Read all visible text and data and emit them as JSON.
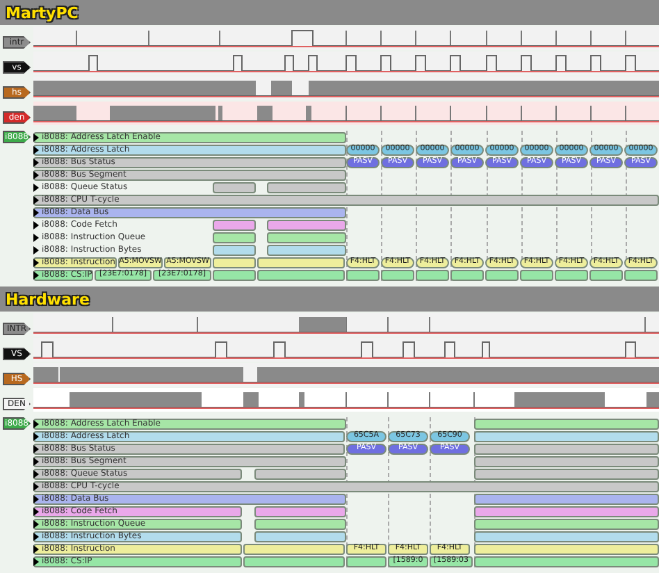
{
  "panels": [
    {
      "title": "MartyPC",
      "signals": [
        {
          "label": "intr",
          "color": "#8c8c8c"
        },
        {
          "label": "vs",
          "color": "#111111"
        },
        {
          "label": "hs",
          "color": "#b8691f"
        },
        {
          "label": "den",
          "color": "#d42a2a"
        }
      ],
      "group": {
        "label": "i8088",
        "color": "#3daa4a"
      },
      "rows": [
        {
          "label": "i8088: Address Latch Enable",
          "color": "#a6e6a6"
        },
        {
          "label": "i8088: Address Latch",
          "color": "#b2dcec",
          "segments": [
            {
              "text": "00000",
              "color": "#7cc6e2"
            },
            {
              "text": "00000",
              "color": "#7cc6e2"
            },
            {
              "text": "00000",
              "color": "#7cc6e2"
            },
            {
              "text": "00000",
              "color": "#7cc6e2"
            },
            {
              "text": "00000",
              "color": "#7cc6e2"
            },
            {
              "text": "00000",
              "color": "#7cc6e2"
            },
            {
              "text": "00000",
              "color": "#7cc6e2"
            },
            {
              "text": "00000",
              "color": "#7cc6e2"
            },
            {
              "text": "00000",
              "color": "#7cc6e2"
            }
          ]
        },
        {
          "label": "i8088: Bus Status",
          "color": "#c8c8c8",
          "segments": [
            {
              "text": "PASV",
              "color": "#6f6fe0"
            },
            {
              "text": "PASV",
              "color": "#6f6fe0"
            },
            {
              "text": "PASV",
              "color": "#6f6fe0"
            },
            {
              "text": "PASV",
              "color": "#6f6fe0"
            },
            {
              "text": "PASV",
              "color": "#6f6fe0"
            },
            {
              "text": "PASV",
              "color": "#6f6fe0"
            },
            {
              "text": "PASV",
              "color": "#6f6fe0"
            },
            {
              "text": "PASV",
              "color": "#6f6fe0"
            },
            {
              "text": "PASV",
              "color": "#6f6fe0"
            }
          ]
        },
        {
          "label": "i8088: Bus Segment",
          "color": "#c8c8c8"
        },
        {
          "label": "i8088: Queue Status",
          "color": "#c8c8c8"
        },
        {
          "label": "i8088: CPU T-cycle",
          "color": "#c8c8c8"
        },
        {
          "label": "i8088: Data Bus",
          "color": "#aab4ee"
        },
        {
          "label": "i8088: Code Fetch",
          "color": "#eaa8ea"
        },
        {
          "label": "i8088: Instruction Queue",
          "color": "#a6e6a6"
        },
        {
          "label": "i8088: Instruction Bytes",
          "color": "#b2dcec"
        },
        {
          "label": "i8088: Instruction",
          "color": "#eeee9c",
          "segments": [
            {
              "text": "A5:MOVSW"
            },
            {
              "text": "A5:MOVSW"
            },
            {
              "text": "F4:HLT"
            },
            {
              "text": "F4:HLT"
            },
            {
              "text": "F4:HLT"
            },
            {
              "text": "F4:HLT"
            },
            {
              "text": "F4:HLT"
            },
            {
              "text": "F4:HLT"
            },
            {
              "text": "F4:HLT"
            },
            {
              "text": "F4:HLT"
            },
            {
              "text": "F4:HLT"
            }
          ]
        },
        {
          "label": "i8088: CS:IP",
          "color": "#96e6a6",
          "segments": [
            {
              "text": "[23E7:0178]"
            },
            {
              "text": "[23E7:0178]"
            }
          ]
        }
      ]
    },
    {
      "title": "Hardware",
      "signals": [
        {
          "label": "INTR",
          "color": "#8c8c8c"
        },
        {
          "label": "VS",
          "color": "#111111"
        },
        {
          "label": "HS",
          "color": "#b8691f"
        },
        {
          "label": "DEN",
          "color": "#f4f4f4"
        }
      ],
      "group": {
        "label": "i8088",
        "color": "#3daa4a"
      },
      "rows": [
        {
          "label": "i8088: Address Latch Enable",
          "color": "#a6e6a6"
        },
        {
          "label": "i8088: Address Latch",
          "color": "#b2dcec",
          "segments": [
            {
              "text": "65C5A",
              "color": "#7cc6e2"
            },
            {
              "text": "65C73",
              "color": "#7cc6e2"
            },
            {
              "text": "65C90",
              "color": "#7cc6e2"
            }
          ]
        },
        {
          "label": "i8088: Bus Status",
          "color": "#c8c8c8",
          "segments": [
            {
              "text": "PASV",
              "color": "#6f6fe0"
            },
            {
              "text": "PASV",
              "color": "#6f6fe0"
            },
            {
              "text": "PASV",
              "color": "#6f6fe0"
            }
          ]
        },
        {
          "label": "i8088: Bus Segment",
          "color": "#c8c8c8"
        },
        {
          "label": "i8088: Queue Status",
          "color": "#c8c8c8"
        },
        {
          "label": "i8088: CPU T-cycle",
          "color": "#c8c8c8"
        },
        {
          "label": "i8088: Data Bus",
          "color": "#aab4ee"
        },
        {
          "label": "i8088: Code Fetch",
          "color": "#eaa8ea"
        },
        {
          "label": "i8088: Instruction Queue",
          "color": "#a6e6a6"
        },
        {
          "label": "i8088: Instruction Bytes",
          "color": "#b2dcec"
        },
        {
          "label": "i8088: Instruction",
          "color": "#eeee9c",
          "segments": [
            {
              "text": "F4:HLT"
            },
            {
              "text": "F4:HLT"
            },
            {
              "text": "F4:HLT"
            }
          ]
        },
        {
          "label": "i8088: CS:IP",
          "color": "#96e6a6",
          "segments": [
            {
              "text": "[1589:0"
            },
            {
              "text": "[1589:03"
            }
          ]
        }
      ]
    }
  ]
}
